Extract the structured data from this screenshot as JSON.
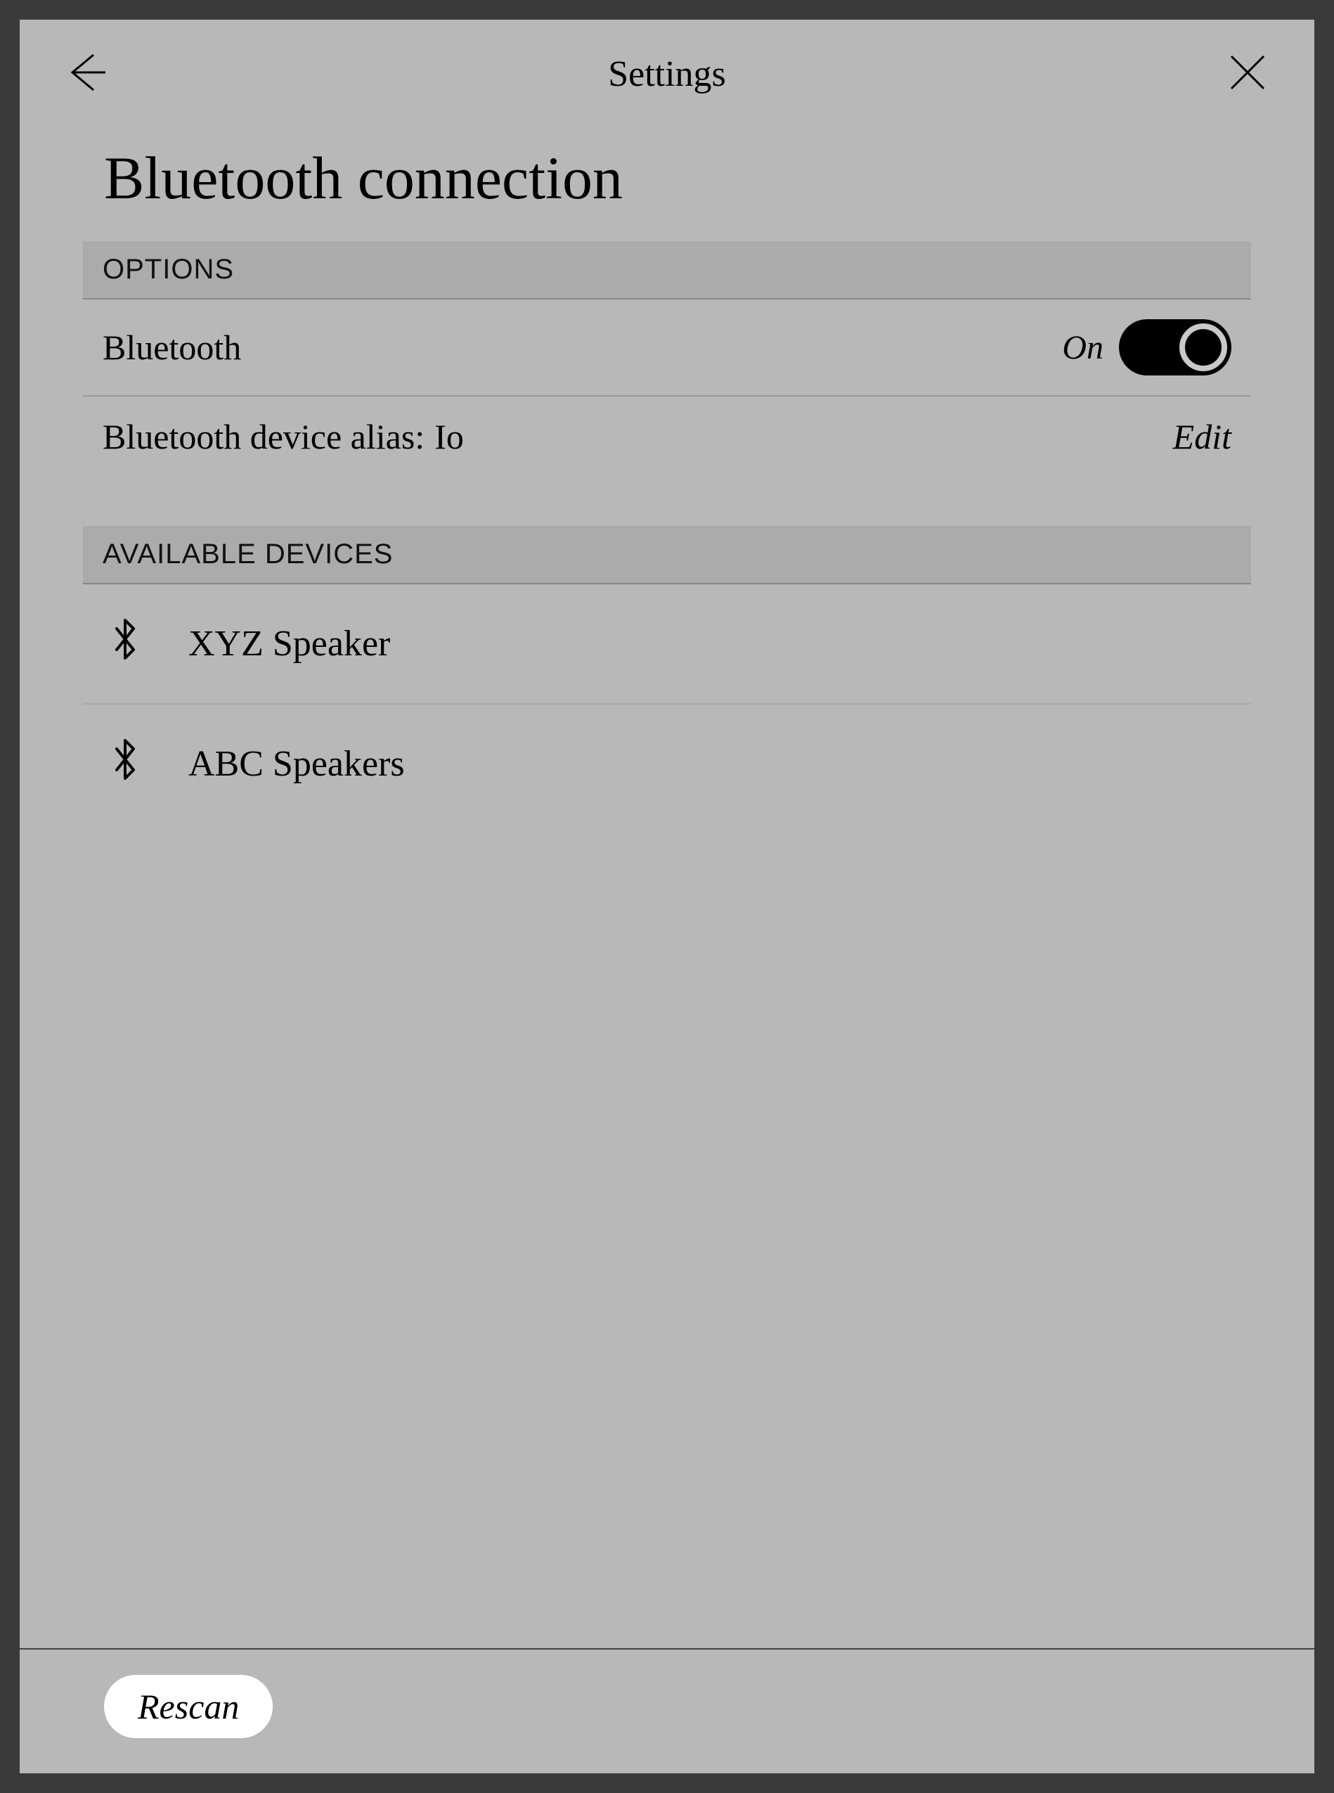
{
  "header": {
    "title": "Settings"
  },
  "page": {
    "title": "Bluetooth connection"
  },
  "sections": {
    "options_header": "OPTIONS",
    "available_header": "AVAILABLE DEVICES"
  },
  "options": {
    "bluetooth_label": "Bluetooth",
    "bluetooth_state": "On",
    "alias_label_prefix": "Bluetooth device alias: ",
    "alias_value": "Io",
    "edit_label": "Edit"
  },
  "devices": [
    {
      "name": "XYZ Speaker"
    },
    {
      "name": "ABC Speakers"
    }
  ],
  "footer": {
    "rescan_label": "Rescan"
  }
}
